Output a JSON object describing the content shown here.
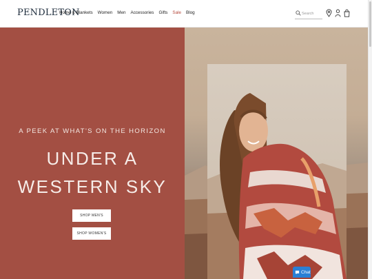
{
  "brand": {
    "logo": "PENDLETON"
  },
  "nav": {
    "items": [
      {
        "label": "Home & Blankets"
      },
      {
        "label": "Women"
      },
      {
        "label": "Men"
      },
      {
        "label": "Accessories"
      },
      {
        "label": "Gifts"
      },
      {
        "label": "Sale"
      },
      {
        "label": "Blog"
      }
    ]
  },
  "search": {
    "placeholder": "Search"
  },
  "header_icons": [
    "location-icon",
    "account-icon",
    "bag-icon"
  ],
  "hero": {
    "eyebrow": "A PEEK AT WHAT'S ON THE HORIZON",
    "headline_line1": "UNDER A",
    "headline_line2": "WESTERN SKY",
    "cta_mens": "SHOP MEN'S",
    "cta_womens": "SHOP WOMEN'S"
  },
  "chat": {
    "label": "Chat"
  },
  "colors": {
    "hero_panel": "#a34f43",
    "sale": "#b4473b",
    "chat": "#2a7fd4"
  }
}
